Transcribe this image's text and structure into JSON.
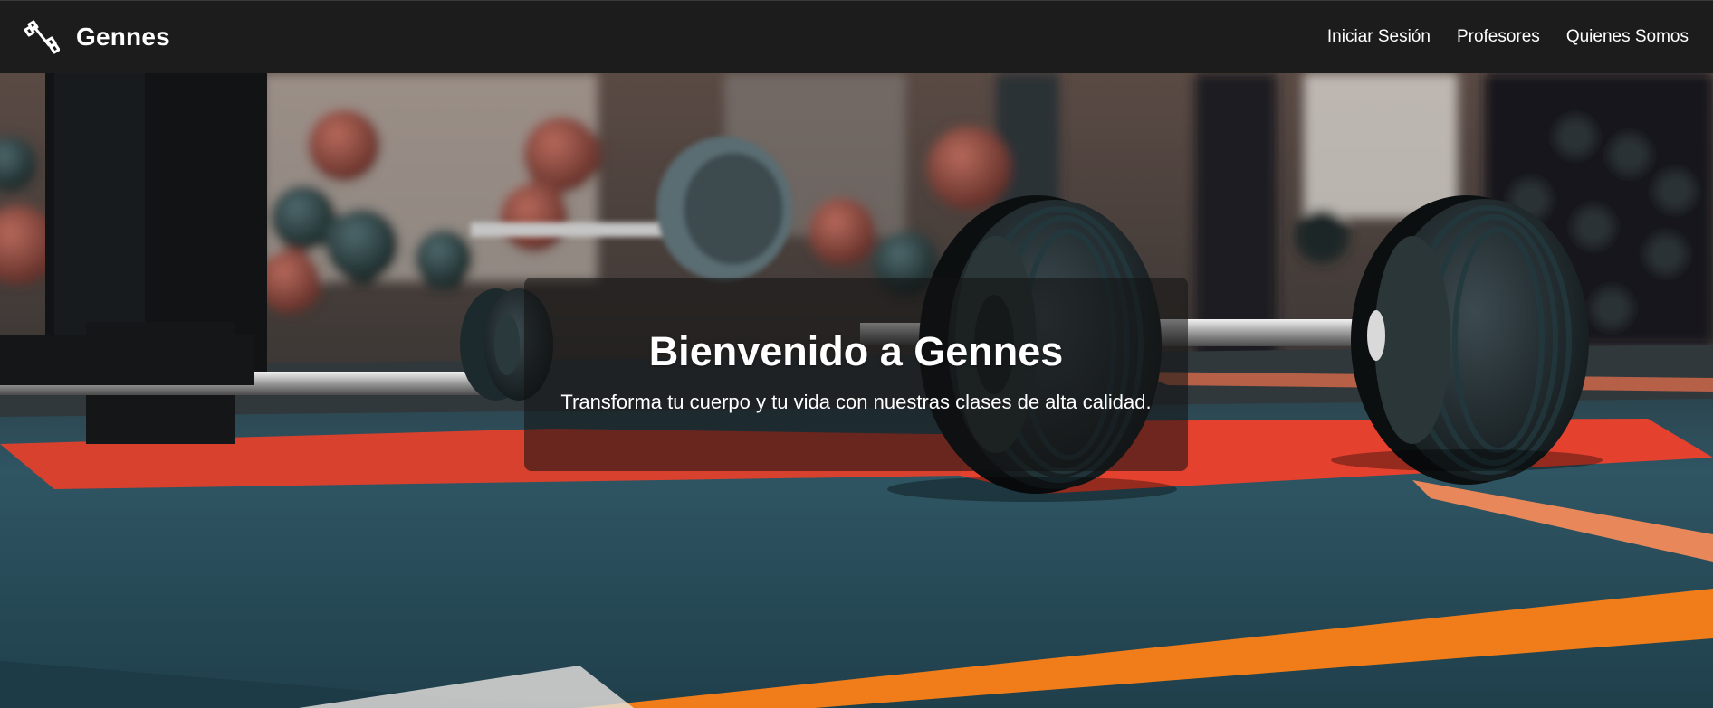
{
  "navbar": {
    "brand_name": "Gennes",
    "brand_icon": "dumbbell-icon",
    "links": [
      {
        "label": "Iniciar Sesión"
      },
      {
        "label": "Profesores"
      },
      {
        "label": "Quienes Somos"
      }
    ]
  },
  "hero": {
    "title": "Bienvenido a Gennes",
    "subtitle": "Transforma tu cuerpo y tu vida con nuestras clases de alta calidad.",
    "background": "gym-barbell-photo"
  },
  "colors": {
    "navbar_bg": "#1c1c1c",
    "text": "#ffffff",
    "overlay": "rgba(18,18,18,0.56)",
    "mat_red": "#d9412f",
    "stripe_orange": "#f07d1a",
    "floor_teal": "#2e5562"
  }
}
